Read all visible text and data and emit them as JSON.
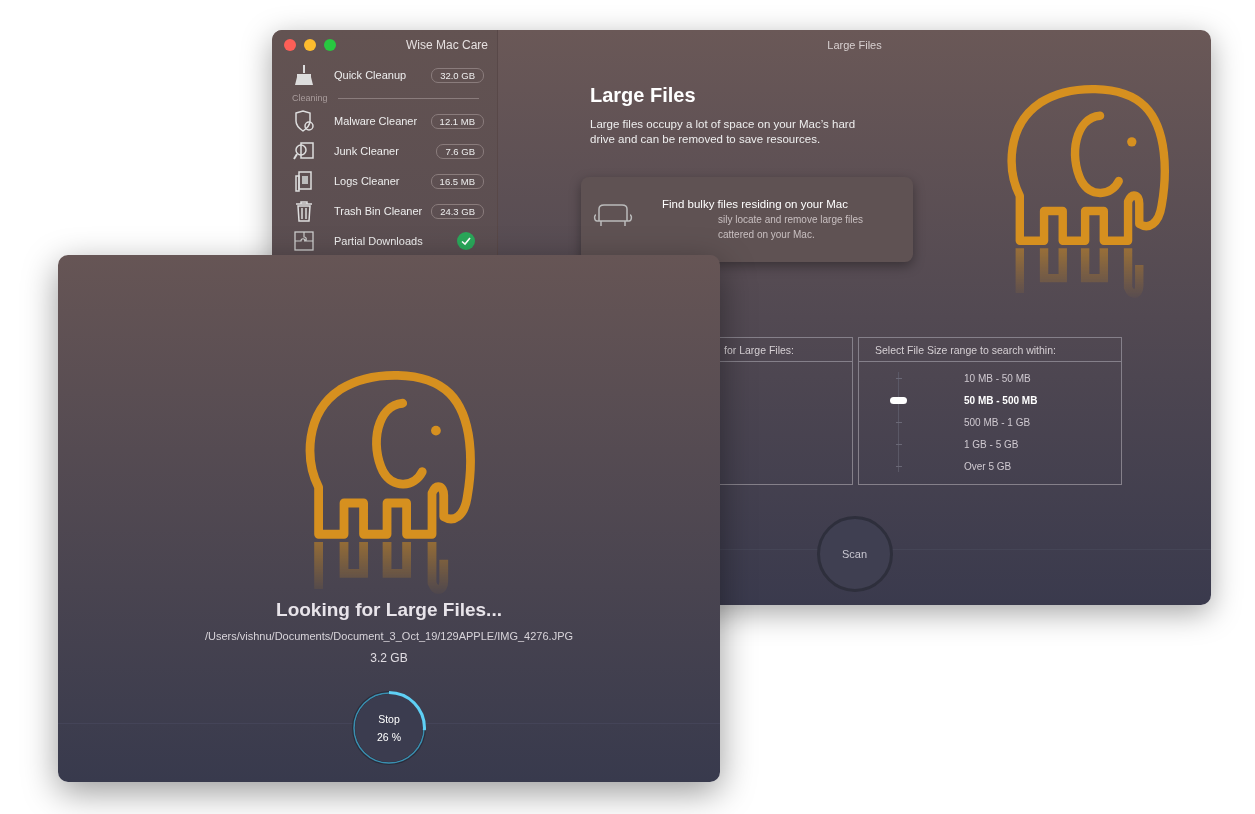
{
  "app_window": {
    "sidebar_title": "Wise Mac Care",
    "content_title": "Large Files",
    "sidebar": {
      "top_item": {
        "label": "Quick Cleanup",
        "badge": "32.0 GB"
      },
      "section": "Cleaning",
      "items": [
        {
          "kind": "badge",
          "label": "Malware Cleaner",
          "badge": "12.1 MB"
        },
        {
          "kind": "badge",
          "label": "Junk Cleaner",
          "badge": "7.6 GB"
        },
        {
          "kind": "badge",
          "label": "Logs Cleaner",
          "badge": "16.5 MB"
        },
        {
          "kind": "badge",
          "label": "Trash Bin Cleaner",
          "badge": "24.3 GB"
        },
        {
          "kind": "check",
          "label": "Partial Downloads"
        }
      ]
    },
    "heading": "Large Files",
    "description": "Large files occupy a lot of space on your Mac’s hard drive and can be removed to save resources.",
    "feature_card": {
      "title": "Find bulky files residing on your Mac",
      "lines": [
        "sily locate and remove large files",
        "cattered on your Mac."
      ]
    },
    "file_type_panel": {
      "header": "for Large Files:"
    },
    "file_size_panel": {
      "header": "Select File Size range to search within:",
      "options": [
        {
          "label": "10 MB - 50 MB",
          "selected": false
        },
        {
          "label": "50 MB - 500 MB",
          "selected": true
        },
        {
          "label": "500 MB - 1 GB",
          "selected": false
        },
        {
          "label": "1 GB - 5 GB",
          "selected": false
        },
        {
          "label": "Over 5 GB",
          "selected": false
        }
      ]
    },
    "scan_button": "Scan"
  },
  "scan_window": {
    "title": "Looking for Large Files...",
    "path": "/Users/vishnu/Documents/Document_3_Oct_19/129APPLE/IMG_4276.JPG",
    "size": "3.2 GB",
    "stop_button": {
      "label": "Stop",
      "percent": "26 %",
      "level": 0.26
    }
  }
}
